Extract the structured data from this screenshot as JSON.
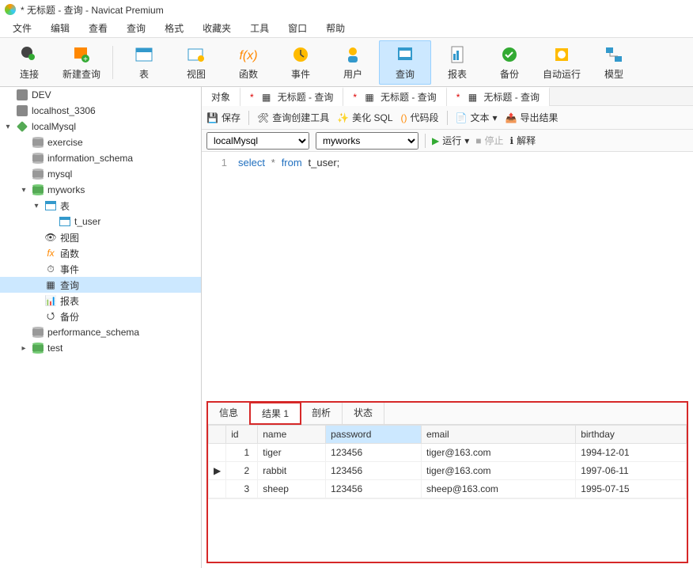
{
  "title": "* 无标题 - 查询 - Navicat Premium",
  "menu": [
    "文件",
    "编辑",
    "查看",
    "查询",
    "格式",
    "收藏夹",
    "工具",
    "窗口",
    "帮助"
  ],
  "toolbar": [
    {
      "key": "connect",
      "label": "连接"
    },
    {
      "key": "newquery",
      "label": "新建查询"
    },
    {
      "key": "sep",
      "label": ""
    },
    {
      "key": "table",
      "label": "表"
    },
    {
      "key": "view",
      "label": "视图"
    },
    {
      "key": "function",
      "label": "函数"
    },
    {
      "key": "event",
      "label": "事件"
    },
    {
      "key": "user",
      "label": "用户"
    },
    {
      "key": "query",
      "label": "查询",
      "active": true
    },
    {
      "key": "report",
      "label": "报表"
    },
    {
      "key": "backup",
      "label": "备份"
    },
    {
      "key": "auto",
      "label": "自动运行"
    },
    {
      "key": "model",
      "label": "模型"
    }
  ],
  "tree": {
    "dev": "DEV",
    "localhost": "localhost_3306",
    "localmysql": "localMysql",
    "databases": {
      "exercise": "exercise",
      "info": "information_schema",
      "mysql": "mysql",
      "myworks": "myworks",
      "myworks_children": {
        "tables": "表",
        "t_user": "t_user",
        "views": "视图",
        "functions": "函数",
        "events": "事件",
        "queries": "查询",
        "reports": "报表",
        "backups": "备份"
      },
      "perf": "performance_schema",
      "test": "test"
    }
  },
  "content_tabs": {
    "objects": "对象",
    "q1": "无标题 - 查询",
    "q2": "无标题 - 查询",
    "q3": "无标题 - 查询"
  },
  "querybar": {
    "save": "保存",
    "builder": "查询创建工具",
    "beautify": "美化 SQL",
    "snippet": "代码段",
    "text": "文本",
    "export": "导出结果"
  },
  "selectors": {
    "conn": "localMysql",
    "db": "myworks",
    "run": "运行",
    "stop": "停止",
    "explain": "解释"
  },
  "editor": {
    "line": "1",
    "sql_select": "select",
    "sql_star": "*",
    "sql_from": "from",
    "sql_table": "t_user;"
  },
  "result_tabs": [
    "信息",
    "结果 1",
    "剖析",
    "状态"
  ],
  "columns": [
    "id",
    "name",
    "password",
    "email",
    "birthday"
  ],
  "rows": [
    {
      "id": "1",
      "name": "tiger",
      "password": "123456",
      "email": "tiger@163.com",
      "birthday": "1994-12-01",
      "current": false
    },
    {
      "id": "2",
      "name": "rabbit",
      "password": "123456",
      "email": "tiger@163.com",
      "birthday": "1997-06-11",
      "current": true
    },
    {
      "id": "3",
      "name": "sheep",
      "password": "123456",
      "email": "sheep@163.com",
      "birthday": "1995-07-15",
      "current": false
    }
  ]
}
